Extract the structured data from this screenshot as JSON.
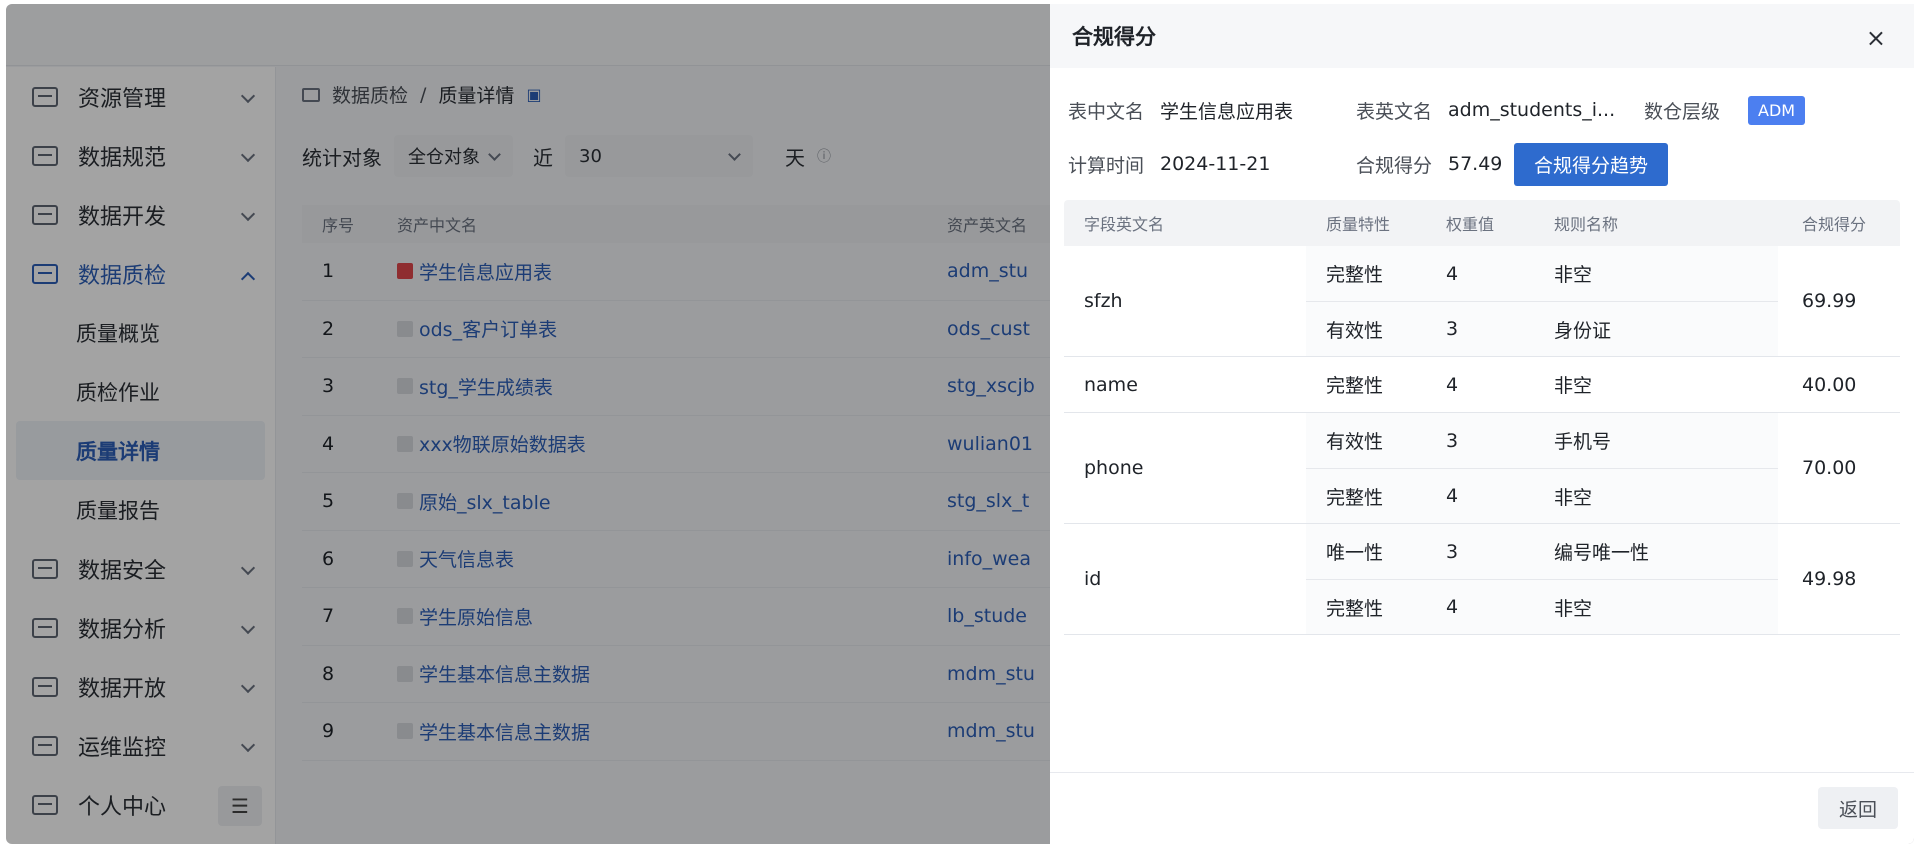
{
  "sidebar": {
    "items": [
      {
        "label": "资源管理",
        "icon": "server-icon"
      },
      {
        "label": "数据规范",
        "icon": "monitor-icon"
      },
      {
        "label": "数据开发",
        "icon": "code-icon"
      },
      {
        "label": "数据质检",
        "icon": "quality-icon",
        "open": true,
        "children": [
          "质量概览",
          "质检作业",
          "质量详情",
          "质量报告"
        ],
        "active_child": "质量详情"
      },
      {
        "label": "数据安全",
        "icon": "security-icon"
      },
      {
        "label": "数据分析",
        "icon": "analysis-icon"
      },
      {
        "label": "数据开放",
        "icon": "open-icon"
      },
      {
        "label": "运维监控",
        "icon": "monitor-chart-icon"
      },
      {
        "label": "个人中心",
        "icon": "user-icon"
      }
    ]
  },
  "breadcrumb": {
    "root": "数据质检",
    "sep": "/",
    "current": "质量详情"
  },
  "filters": {
    "object_label": "统计对象",
    "object_value": "全仓对象",
    "near_label": "近",
    "days_value": "30",
    "unit": "天"
  },
  "grid": {
    "headers": [
      "序号",
      "资产中文名",
      "资产英文名"
    ],
    "rows": [
      {
        "idx": "1",
        "cn": "学生信息应用表",
        "en": "adm_stu",
        "flag": "red"
      },
      {
        "idx": "2",
        "cn": "ods_客户订单表",
        "en": "ods_cust",
        "flag": "gray"
      },
      {
        "idx": "3",
        "cn": "stg_学生成绩表",
        "en": "stg_xscjb",
        "flag": "gray"
      },
      {
        "idx": "4",
        "cn": "xxx物联原始数据表",
        "en": "wulian01",
        "flag": "gray"
      },
      {
        "idx": "5",
        "cn": "原始_slx_table",
        "en": "stg_slx_t",
        "flag": "gray"
      },
      {
        "idx": "6",
        "cn": "天气信息表",
        "en": "info_wea",
        "flag": "gray"
      },
      {
        "idx": "7",
        "cn": "学生原始信息",
        "en": "lb_stude",
        "flag": "gray"
      },
      {
        "idx": "8",
        "cn": "学生基本信息主数据",
        "en": "mdm_stu",
        "flag": "gray"
      },
      {
        "idx": "9",
        "cn": "学生基本信息主数据",
        "en": "mdm_stu",
        "flag": "gray"
      }
    ]
  },
  "drawer": {
    "title": "合规得分",
    "close_glyph": "×",
    "meta": {
      "cn_name_label": "表中文名",
      "cn_name": "学生信息应用表",
      "en_name_label": "表英文名",
      "en_name": "adm_students_i...",
      "layer_label": "数仓层级",
      "layer": "ADM",
      "time_label": "计算时间",
      "time": "2024-11-21",
      "score_label": "合规得分",
      "score": "57.49",
      "trend_button": "合规得分趋势"
    },
    "table": {
      "headers": {
        "field": "字段英文名",
        "quality": "质量特性",
        "weight": "权重值",
        "rule": "规则名称",
        "score": "合规得分"
      },
      "groups": [
        {
          "field": "sfzh",
          "score": "69.99",
          "rules": [
            {
              "quality": "完整性",
              "weight": "4",
              "rule": "非空"
            },
            {
              "quality": "有效性",
              "weight": "3",
              "rule": "身份证"
            }
          ]
        },
        {
          "field": "name",
          "score": "40.00",
          "rules": [
            {
              "quality": "完整性",
              "weight": "4",
              "rule": "非空"
            }
          ]
        },
        {
          "field": "phone",
          "score": "70.00",
          "rules": [
            {
              "quality": "有效性",
              "weight": "3",
              "rule": "手机号"
            },
            {
              "quality": "完整性",
              "weight": "4",
              "rule": "非空"
            }
          ]
        },
        {
          "field": "id",
          "score": "49.98",
          "rules": [
            {
              "quality": "唯一性",
              "weight": "3",
              "rule": "编号唯一性"
            },
            {
              "quality": "完整性",
              "weight": "4",
              "rule": "非空"
            }
          ]
        }
      ]
    },
    "back_button": "返回"
  },
  "colors": {
    "accent": "#2e6bce",
    "tag": "#4c7ff0",
    "flag_red": "#e0474b"
  }
}
